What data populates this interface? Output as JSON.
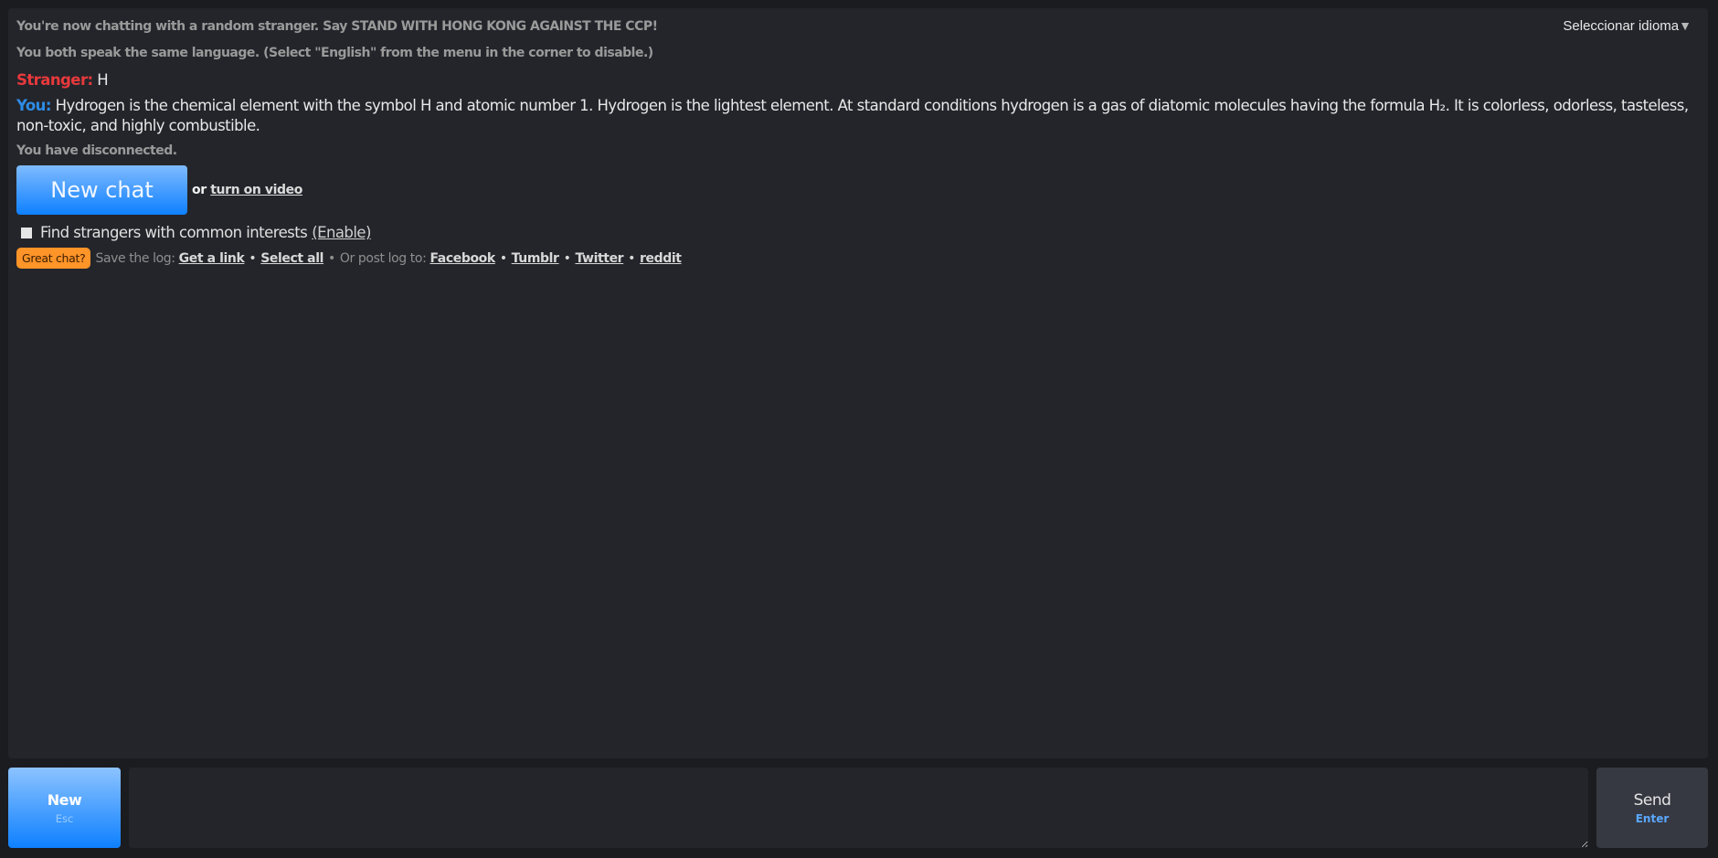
{
  "language_selector": {
    "label": "Seleccionar idioma",
    "arrow": "▼"
  },
  "log": {
    "status_connected": "You're now chatting with a random stranger. Say STAND WITH HONG KONG AGAINST THE CCP!",
    "status_language": "You both speak the same language. (Select \"English\" from the menu in the corner to disable.)",
    "messages": [
      {
        "sender": "Stranger:",
        "text": " H",
        "color": "#e8393c"
      },
      {
        "sender": "You:",
        "text": " Hydrogen is the chemical element with the symbol H and atomic number 1. Hydrogen is the lightest element. At standard conditions hydrogen is a gas of diatomic molecules having the formula H₂. It is colorless, odorless, tasteless, non-toxic, and highly combustible.",
        "color": "#2d8ce6"
      }
    ],
    "status_disconnected": "You have disconnected."
  },
  "actions": {
    "new_chat_label": "New chat",
    "or_text": "or",
    "turn_on_video_label": "turn on video",
    "interests_text": "Find strangers with common interests",
    "enable_label": "(Enable)",
    "great_chat_label": "Great chat?",
    "save_log_text": "Save the log:",
    "get_link_label": "Get a link",
    "bullet": "•",
    "select_all_label": "Select all",
    "post_log_text": "Or post log to:",
    "facebook_label": "Facebook",
    "tumblr_label": "Tumblr",
    "twitter_label": "Twitter",
    "reddit_label": "reddit"
  },
  "bottom_bar": {
    "new_label": "New",
    "new_shortcut": "Esc",
    "message_value": "",
    "send_label": "Send",
    "send_shortcut": "Enter"
  },
  "colors": {
    "accent_blue": "#0e80ff",
    "stranger_red": "#e8393c",
    "you_blue": "#2d8ce6",
    "great_chat_orange": "#ff9428"
  }
}
